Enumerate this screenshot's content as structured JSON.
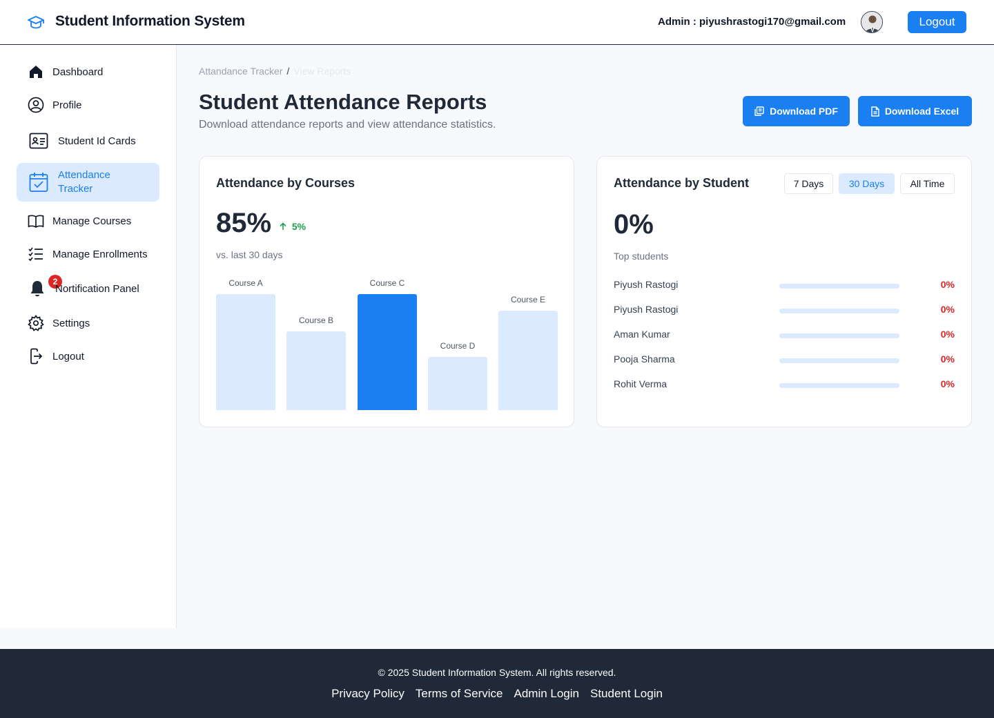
{
  "header": {
    "title": "Student Information System",
    "admin_label": "Admin : piyushrastogi170@gmail.com",
    "logout_label": "Logout"
  },
  "sidebar": {
    "items": [
      {
        "label": "Dashboard",
        "icon": "home-icon"
      },
      {
        "label": "Profile",
        "icon": "user-circle-icon"
      },
      {
        "label": "Student Id Cards",
        "icon": "id-card-icon"
      },
      {
        "label": "Attendance Tracker",
        "icon": "calendar-check-icon",
        "active": true
      },
      {
        "label": "Manage Courses",
        "icon": "book-open-icon"
      },
      {
        "label": "Manage Enrollments",
        "icon": "checklist-icon"
      },
      {
        "label": "Nortification Panel",
        "icon": "bell-icon",
        "badge": "2"
      },
      {
        "label": "Settings",
        "icon": "gear-icon"
      },
      {
        "label": "Logout",
        "icon": "logout-icon"
      }
    ]
  },
  "breadcrumb": {
    "parent": "Attandance Tracker",
    "separator": "/",
    "current": "View Reports"
  },
  "page": {
    "title": "Student Attendance Reports",
    "subtitle": "Download attendance reports and view attendance statistics.",
    "download_pdf": "Download PDF",
    "download_excel": "Download Excel"
  },
  "courses_card": {
    "title": "Attendance by Courses",
    "stat": "85%",
    "trend": "5%",
    "trend_direction": "up",
    "stat_sub": "vs. last 30 days",
    "chart_data": {
      "type": "bar",
      "categories": [
        "Course A",
        "Course B",
        "Course C",
        "Course D",
        "Course E"
      ],
      "values": [
        100,
        68,
        100,
        46,
        86
      ],
      "highlighted": "Course C",
      "ylim": [
        0,
        100
      ]
    }
  },
  "student_card": {
    "title": "Attendance by Student",
    "filters": [
      {
        "label": "7 Days",
        "active": false
      },
      {
        "label": "30 Days",
        "active": true
      },
      {
        "label": "All Time",
        "active": false
      }
    ],
    "stat": "0%",
    "stat_sub": "Top students",
    "students": [
      {
        "name": "Piyush Rastogi",
        "percent": "0%",
        "value": 0
      },
      {
        "name": "Piyush Rastogi",
        "percent": "0%",
        "value": 0
      },
      {
        "name": "Aman Kumar",
        "percent": "0%",
        "value": 0
      },
      {
        "name": "Pooja Sharma",
        "percent": "0%",
        "value": 0
      },
      {
        "name": "Rohit Verma",
        "percent": "0%",
        "value": 0
      }
    ]
  },
  "footer": {
    "copyright": "© 2025 Student Information System. All rights reserved.",
    "links": [
      "Privacy Policy",
      "Terms of Service",
      "Admin Login",
      "Student Login"
    ]
  },
  "colors": {
    "accent": "#1a7ff0",
    "accent_light": "#dbeafe",
    "danger": "#dc2626",
    "success": "#16a34a",
    "footer_bg": "#1f2937"
  }
}
